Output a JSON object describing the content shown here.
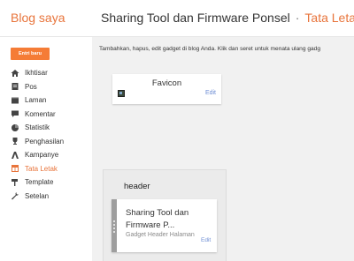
{
  "topbar": {
    "brand": "Blog saya",
    "blog_title": "Sharing Tool dan Firmware Ponsel",
    "separator": "·",
    "section": "Tata Letak"
  },
  "sidebar": {
    "new_post": "Entri baru",
    "items": [
      {
        "label": "Ikhtisar",
        "icon": "home-icon"
      },
      {
        "label": "Pos",
        "icon": "document-icon"
      },
      {
        "label": "Laman",
        "icon": "page-icon"
      },
      {
        "label": "Komentar",
        "icon": "comment-icon"
      },
      {
        "label": "Statistik",
        "icon": "pie-chart-icon"
      },
      {
        "label": "Penghasilan",
        "icon": "trophy-icon"
      },
      {
        "label": "Kampanye",
        "icon": "campaign-icon"
      },
      {
        "label": "Tata Letak",
        "icon": "layout-icon",
        "active": true
      },
      {
        "label": "Template",
        "icon": "paint-roller-icon"
      },
      {
        "label": "Setelan",
        "icon": "wrench-icon"
      }
    ]
  },
  "main": {
    "description": "Tambahkan, hapus, edit gadget di blog Anda. Klik dan seret untuk menata ulang gadg",
    "favicon_gadget": {
      "title": "Favicon",
      "edit": "Edit"
    },
    "header_section": {
      "label": "header",
      "gadget_title": "Sharing Tool dan Firmware P...",
      "gadget_subtitle": "Gadget Header Halaman",
      "edit": "Edit"
    }
  },
  "colors": {
    "accent": "#e8743b",
    "button": "#f57c36",
    "link": "#6d8dd4"
  }
}
